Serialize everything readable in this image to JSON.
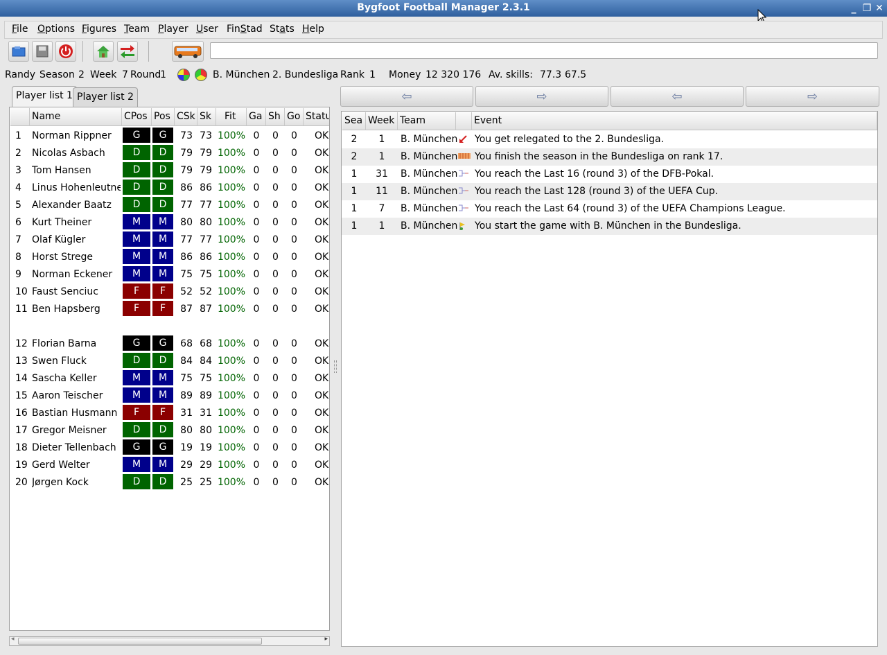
{
  "window": {
    "title": "Bygfoot Football Manager 2.3.1"
  },
  "menu": [
    {
      "label": "File",
      "u": "F",
      "rest": "ile"
    },
    {
      "label": "Options",
      "u": "O",
      "rest": "ptions"
    },
    {
      "label": "Figures",
      "u": "F",
      "rest": "igures"
    },
    {
      "label": "Team",
      "u": "T",
      "rest": "eam"
    },
    {
      "label": "Player",
      "u": "P",
      "rest": "layer"
    },
    {
      "label": "User",
      "u": "U",
      "rest": "ser"
    },
    {
      "label": "FinStad",
      "pre": "Fin",
      "u": "S",
      "rest": "tad"
    },
    {
      "label": "Stats",
      "pre": "St",
      "u": "a",
      "rest": "ts"
    },
    {
      "label": "Help",
      "u": "H",
      "rest": "elp"
    }
  ],
  "info": {
    "user": "Randy",
    "season_label": "Season",
    "season": "2",
    "week_label": "Week",
    "week": "7",
    "round_label": "Round",
    "round": "1",
    "team": "B. München",
    "league": "2. Bundesliga",
    "rank_label": "Rank",
    "rank": "1",
    "money_label": "Money",
    "money": "12 320 176",
    "avskills_label": "Av. skills:",
    "avskills1": "77.3",
    "avskills2": "67.5"
  },
  "tabs": [
    "Player list 1",
    "Player list 2"
  ],
  "player_columns": [
    "",
    "Name",
    "CPos",
    "Pos",
    "CSk",
    "Sk",
    "Fit",
    "Ga",
    "Sh",
    "Go",
    "Status"
  ],
  "players": [
    {
      "n": "1",
      "name": "Norman Rippner",
      "cpos": "G",
      "pos": "G",
      "csk": "73",
      "sk": "73",
      "fit": "100%",
      "ga": "0",
      "sh": "0",
      "go": "0",
      "status": "OK"
    },
    {
      "n": "2",
      "name": "Nicolas Asbach",
      "cpos": "D",
      "pos": "D",
      "csk": "79",
      "sk": "79",
      "fit": "100%",
      "ga": "0",
      "sh": "0",
      "go": "0",
      "status": "OK"
    },
    {
      "n": "3",
      "name": "Tom Hansen",
      "cpos": "D",
      "pos": "D",
      "csk": "79",
      "sk": "79",
      "fit": "100%",
      "ga": "0",
      "sh": "0",
      "go": "0",
      "status": "OK"
    },
    {
      "n": "4",
      "name": "Linus Hohenleutner",
      "cpos": "D",
      "pos": "D",
      "csk": "86",
      "sk": "86",
      "fit": "100%",
      "ga": "0",
      "sh": "0",
      "go": "0",
      "status": "OK"
    },
    {
      "n": "5",
      "name": "Alexander Baatz",
      "cpos": "D",
      "pos": "D",
      "csk": "77",
      "sk": "77",
      "fit": "100%",
      "ga": "0",
      "sh": "0",
      "go": "0",
      "status": "OK"
    },
    {
      "n": "6",
      "name": "Kurt Theiner",
      "cpos": "M",
      "pos": "M",
      "csk": "80",
      "sk": "80",
      "fit": "100%",
      "ga": "0",
      "sh": "0",
      "go": "0",
      "status": "OK"
    },
    {
      "n": "7",
      "name": "Olaf Kügler",
      "cpos": "M",
      "pos": "M",
      "csk": "77",
      "sk": "77",
      "fit": "100%",
      "ga": "0",
      "sh": "0",
      "go": "0",
      "status": "OK"
    },
    {
      "n": "8",
      "name": "Horst Strege",
      "cpos": "M",
      "pos": "M",
      "csk": "86",
      "sk": "86",
      "fit": "100%",
      "ga": "0",
      "sh": "0",
      "go": "0",
      "status": "OK"
    },
    {
      "n": "9",
      "name": "Norman Eckener",
      "cpos": "M",
      "pos": "M",
      "csk": "75",
      "sk": "75",
      "fit": "100%",
      "ga": "0",
      "sh": "0",
      "go": "0",
      "status": "OK"
    },
    {
      "n": "10",
      "name": "Faust Senciuc",
      "cpos": "F",
      "pos": "F",
      "csk": "52",
      "sk": "52",
      "fit": "100%",
      "ga": "0",
      "sh": "0",
      "go": "0",
      "status": "OK"
    },
    {
      "n": "11",
      "name": "Ben Hapsberg",
      "cpos": "F",
      "pos": "F",
      "csk": "87",
      "sk": "87",
      "fit": "100%",
      "ga": "0",
      "sh": "0",
      "go": "0",
      "status": "OK"
    },
    {
      "n": "12",
      "name": "Florian Barna",
      "cpos": "G",
      "pos": "G",
      "csk": "68",
      "sk": "68",
      "fit": "100%",
      "ga": "0",
      "sh": "0",
      "go": "0",
      "status": "OK"
    },
    {
      "n": "13",
      "name": "Swen Fluck",
      "cpos": "D",
      "pos": "D",
      "csk": "84",
      "sk": "84",
      "fit": "100%",
      "ga": "0",
      "sh": "0",
      "go": "0",
      "status": "OK"
    },
    {
      "n": "14",
      "name": "Sascha Keller",
      "cpos": "M",
      "pos": "M",
      "csk": "75",
      "sk": "75",
      "fit": "100%",
      "ga": "0",
      "sh": "0",
      "go": "0",
      "status": "OK"
    },
    {
      "n": "15",
      "name": "Aaron Teischer",
      "cpos": "M",
      "pos": "M",
      "csk": "89",
      "sk": "89",
      "fit": "100%",
      "ga": "0",
      "sh": "0",
      "go": "0",
      "status": "OK"
    },
    {
      "n": "16",
      "name": "Bastian Husmann",
      "cpos": "F",
      "pos": "F",
      "csk": "31",
      "sk": "31",
      "fit": "100%",
      "ga": "0",
      "sh": "0",
      "go": "0",
      "status": "OK"
    },
    {
      "n": "17",
      "name": "Gregor Meisner",
      "cpos": "D",
      "pos": "D",
      "csk": "80",
      "sk": "80",
      "fit": "100%",
      "ga": "0",
      "sh": "0",
      "go": "0",
      "status": "OK"
    },
    {
      "n": "18",
      "name": "Dieter Tellenbach",
      "cpos": "G",
      "pos": "G",
      "csk": "19",
      "sk": "19",
      "fit": "100%",
      "ga": "0",
      "sh": "0",
      "go": "0",
      "status": "OK"
    },
    {
      "n": "19",
      "name": "Gerd Welter",
      "cpos": "M",
      "pos": "M",
      "csk": "29",
      "sk": "29",
      "fit": "100%",
      "ga": "0",
      "sh": "0",
      "go": "0",
      "status": "OK"
    },
    {
      "n": "20",
      "name": "Jørgen Kock",
      "cpos": "D",
      "pos": "D",
      "csk": "25",
      "sk": "25",
      "fit": "100%",
      "ga": "0",
      "sh": "0",
      "go": "0",
      "status": "OK"
    }
  ],
  "position_colors": {
    "G": "#000000",
    "D": "#006400",
    "M": "#00008b",
    "F": "#8b0000"
  },
  "fit_color": "#006400",
  "event_columns": [
    "Sea",
    "Week",
    "Team",
    "",
    "Event"
  ],
  "events": [
    {
      "sea": "2",
      "week": "1",
      "team": "B. München",
      "icon": "relegation-arrow-icon",
      "event": "You get relegated to the 2. Bundesliga."
    },
    {
      "sea": "2",
      "week": "1",
      "team": "B. München",
      "icon": "league-table-icon",
      "event": "You finish the season in the Bundesliga on rank 17."
    },
    {
      "sea": "1",
      "week": "31",
      "team": "B. München",
      "icon": "cup-bracket-icon",
      "event": "You reach the Last 16 (round 3) of the DFB-Pokal."
    },
    {
      "sea": "1",
      "week": "11",
      "team": "B. München",
      "icon": "cup-bracket-icon",
      "event": "You reach the Last 128 (round 3) of the UEFA Cup."
    },
    {
      "sea": "1",
      "week": "7",
      "team": "B. München",
      "icon": "cup-bracket-icon",
      "event": "You reach the Last 64 (round 3) of the UEFA Champions League."
    },
    {
      "sea": "1",
      "week": "1",
      "team": "B. München",
      "icon": "start-flag-icon",
      "event": "You start the game with B. München in the Bundesliga."
    }
  ]
}
